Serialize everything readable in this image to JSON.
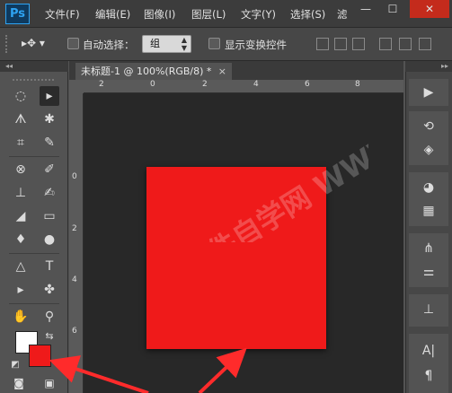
{
  "app": {
    "logo": "Ps",
    "menu": [
      "文件(F)",
      "编辑(E)",
      "图像(I)",
      "图层(L)",
      "文字(Y)",
      "选择(S)",
      "滤"
    ],
    "window_controls": [
      "—",
      "☐",
      "✕"
    ]
  },
  "options_bar": {
    "move_tool_glyph": "▸✥ ▾",
    "auto_select_label": "自动选择：",
    "auto_select_value": "组",
    "show_transform_label": "显示变换控件"
  },
  "panel_collapse_glyph": "◂◂",
  "dock_collapse_glyph": "▸▸",
  "document": {
    "tab_title": "未标题-1 @ 100%(RGB/8) *",
    "tab_close": "×",
    "ruler_top_labels": [
      "2",
      "0",
      "2",
      "4",
      "6",
      "8"
    ],
    "ruler_left_labels": [
      "0",
      "2",
      "4",
      "6"
    ]
  },
  "colors": {
    "foreground": "#ffffff",
    "background": "#ef1a1a",
    "square": "#ef1a1a",
    "annotation_arrow": "#ff2b2b"
  },
  "tools": [
    "rect-marquee-icon",
    "move-icon",
    "lasso-icon",
    "magic-wand-icon",
    "crop-icon",
    "eyedropper-icon",
    "healing-brush-icon",
    "brush-icon",
    "clone-stamp-icon",
    "history-brush-icon",
    "eraser-icon",
    "gradient-icon",
    "blur-icon",
    "dodge-icon",
    "pen-icon",
    "type-icon",
    "path-select-icon",
    "custom-shape-icon",
    "hand-icon",
    "zoom-icon"
  ],
  "dock_icons": [
    "play-icon",
    "history-icon",
    "3d-icon",
    "color-palette-icon",
    "swatches-icon",
    "brush-presets-icon",
    "adjustments-icon",
    "styles-icon",
    "character-icon",
    "paragraph-icon"
  ],
  "watermark": "软件自学网 WWW.RJZXW.COM"
}
